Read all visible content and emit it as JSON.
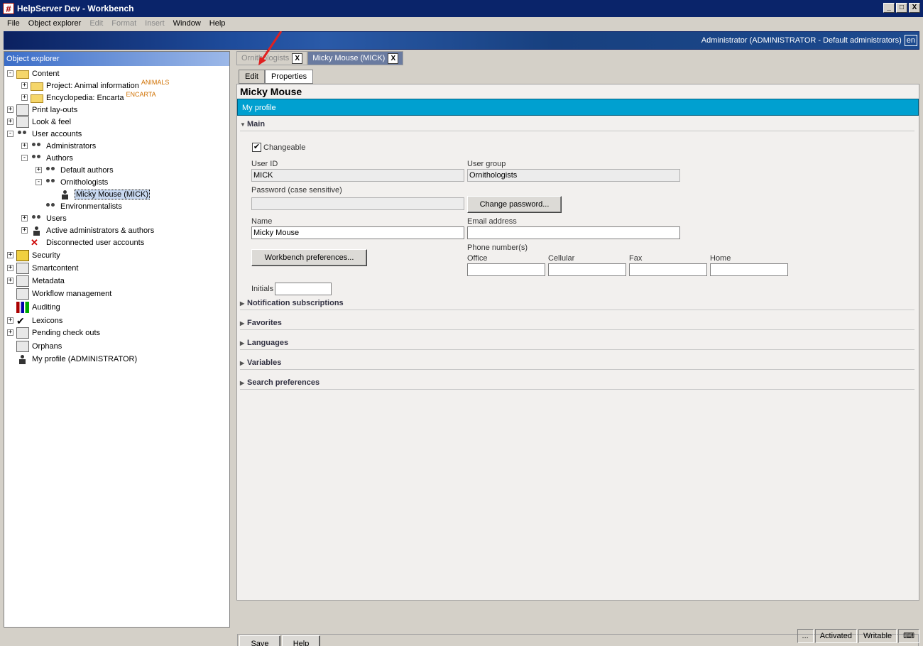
{
  "window": {
    "title": "HelpServer Dev - Workbench",
    "min": "_",
    "max": "□",
    "close": "X"
  },
  "menu": [
    {
      "label": "File",
      "enabled": true
    },
    {
      "label": "Object explorer",
      "enabled": true
    },
    {
      "label": "Edit",
      "enabled": false
    },
    {
      "label": "Format",
      "enabled": false
    },
    {
      "label": "Insert",
      "enabled": false
    },
    {
      "label": "Window",
      "enabled": true
    },
    {
      "label": "Help",
      "enabled": true
    }
  ],
  "banner": {
    "user": "Administrator (ADMINISTRATOR - Default administrators)",
    "lang": "en"
  },
  "explorer": {
    "header": "Object explorer",
    "items": [
      {
        "label": "Content",
        "expander": "-",
        "icon": "folder-icon"
      },
      {
        "label": "Project: Animal information",
        "badge": "ANIMALS",
        "expander": "+",
        "icon": "folder-icon"
      },
      {
        "label": "Encyclopedia: Encarta",
        "badge": "ENCARTA",
        "expander": "+",
        "icon": "folder-icon"
      },
      {
        "label": "Print lay-outs",
        "expander": "+",
        "icon": "printer-icon"
      },
      {
        "label": "Look & feel",
        "expander": "+",
        "icon": "monitor-icon"
      },
      {
        "label": "User accounts",
        "expander": "-",
        "icon": "users-icon"
      },
      {
        "label": "Administrators",
        "expander": "+",
        "icon": "users-icon"
      },
      {
        "label": "Authors",
        "expander": "-",
        "icon": "users-icon"
      },
      {
        "label": "Default authors",
        "expander": "+",
        "icon": "users-icon"
      },
      {
        "label": "Ornithologists",
        "expander": "-",
        "icon": "users-icon"
      },
      {
        "label": "Micky Mouse (MICK)",
        "expander": "",
        "icon": "user-icon"
      },
      {
        "label": "Environmentalists",
        "expander": "",
        "icon": "users-icon"
      },
      {
        "label": "Users",
        "expander": "+",
        "icon": "users-icon"
      },
      {
        "label": "Active administrators & authors",
        "expander": "+",
        "icon": "active-user-icon"
      },
      {
        "label": "Disconnected user accounts",
        "expander": "",
        "icon": "disconnected-user-icon"
      },
      {
        "label": "Security",
        "expander": "+",
        "icon": "lock-icon"
      },
      {
        "label": "Smartcontent",
        "expander": "+",
        "icon": "smartcontent-icon"
      },
      {
        "label": "Metadata",
        "expander": "+",
        "icon": "metadata-icon"
      },
      {
        "label": "Workflow management",
        "expander": "",
        "icon": "workflow-icon"
      },
      {
        "label": "Auditing",
        "expander": "",
        "icon": "chart-icon"
      },
      {
        "label": "Lexicons",
        "expander": "+",
        "icon": "spellcheck-icon"
      },
      {
        "label": "Pending check outs",
        "expander": "+",
        "icon": "checkout-icon"
      },
      {
        "label": "Orphans",
        "expander": "",
        "icon": "orphans-icon"
      },
      {
        "label": "My profile (ADMINISTRATOR)",
        "expander": "",
        "icon": "user-icon"
      }
    ]
  },
  "doc_tabs": [
    {
      "label": "Ornithologists",
      "close": "X"
    },
    {
      "label": "Micky Mouse (MICK)",
      "close": "X"
    }
  ],
  "sub_tabs": [
    "Edit",
    "Properties"
  ],
  "editor": {
    "title": "Micky Mouse",
    "profile_bar": "My profile",
    "sections": [
      "Main",
      "Notification subscriptions",
      "Favorites",
      "Languages",
      "Variables",
      "Search preferences"
    ],
    "changeable_label": "Changeable",
    "changeable_checked": "✔",
    "user_id_label": "User ID",
    "user_id": "MICK",
    "user_group_label": "User group",
    "user_group": "Ornithologists",
    "password_label": "Password (case sensitive)",
    "change_password": "Change password...",
    "name_label": "Name",
    "name": "Micky Mouse",
    "email_label": "Email address",
    "email": "",
    "workbench_prefs": "Workbench preferences...",
    "phone_label": "Phone number(s)",
    "office_label": "Office",
    "cellular_label": "Cellular",
    "fax_label": "Fax",
    "home_label": "Home",
    "initials_label": "Initials"
  },
  "actions": {
    "save": "Save",
    "help": "Help"
  },
  "status": {
    "more": "...",
    "activated": "Activated",
    "writable": "Writable"
  },
  "accent": {
    "profile_bar": "#00a0d0",
    "titlebar": "#0a246a",
    "annotation_arrow": "#e02020"
  }
}
